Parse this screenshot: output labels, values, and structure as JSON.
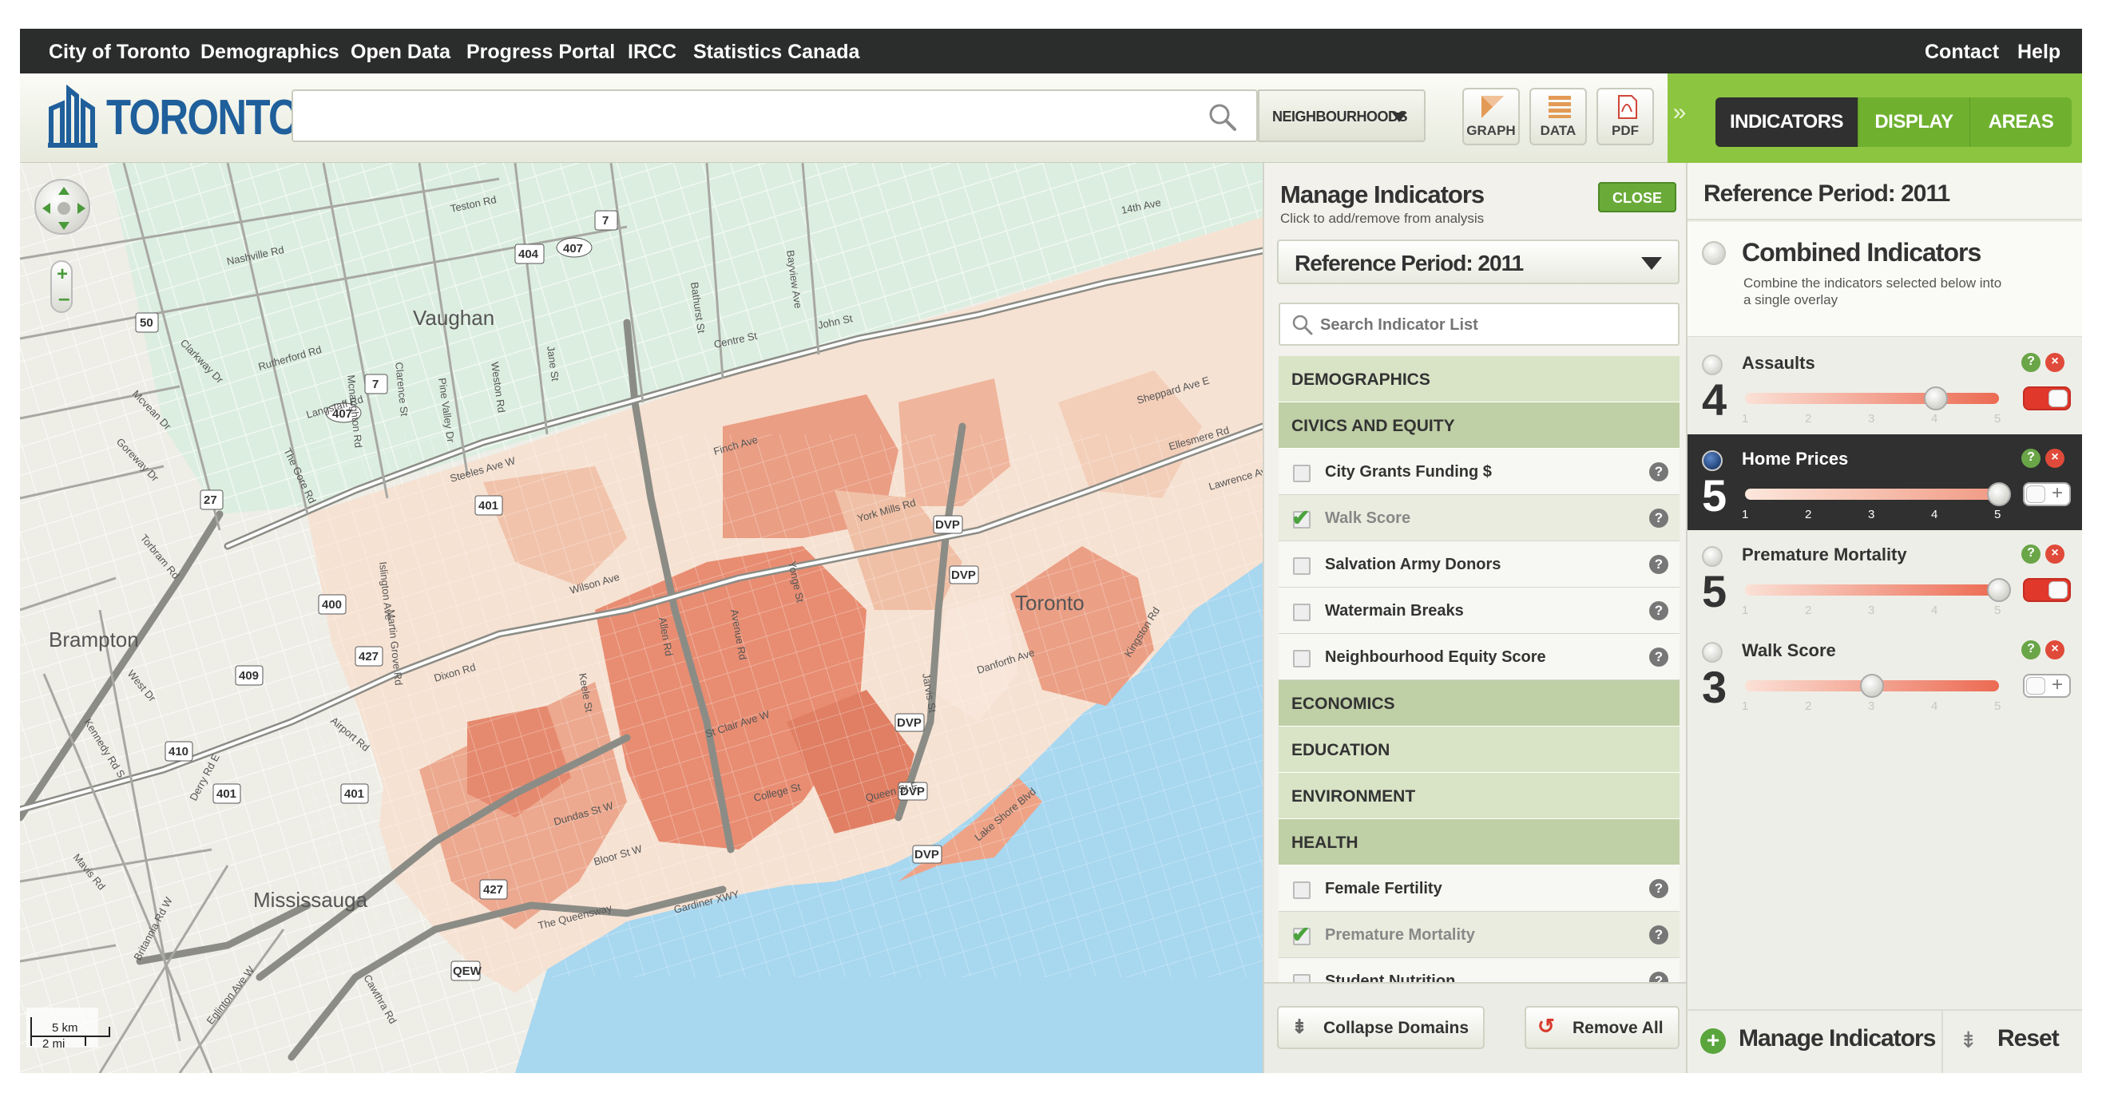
{
  "topnav": {
    "links": [
      "City of Toronto",
      "Demographics",
      "Open Data",
      "Progress Portal",
      "IRCC",
      "Statistics Canada"
    ],
    "right_links": [
      "Contact",
      "Help"
    ]
  },
  "header": {
    "logo_text": "TORONTO",
    "search": {
      "placeholder": "",
      "value": ""
    },
    "scope": "NEIGHBOURHOODS",
    "tools": [
      "GRAPH",
      "DATA",
      "PDF"
    ],
    "tabs": [
      "INDICATORS",
      "DISPLAY",
      "AREAS"
    ],
    "active_tab": "INDICATORS"
  },
  "map": {
    "cities": [
      "Vaughan",
      "Brampton",
      "Mississauga",
      "Toronto"
    ],
    "roads": [
      "Teston Rd",
      "Nashville Rd",
      "Rutherford Rd",
      "Langstaff Rd",
      "Steeles Ave W",
      "Centre St",
      "John St",
      "14th Ave",
      "Clarkway Dr",
      "Mcvean Dr",
      "Goreway Dr",
      "Torbram Rd",
      "West Dr",
      "Kennedy Rd S",
      "Airport Rd",
      "Derry Rd E",
      "Mavis Rd",
      "Britannia Rd W",
      "Eglinton Ave W",
      "Cawthra Rd",
      "Dundas St W",
      "Bloor St W",
      "The Queensway",
      "Gardiner XWY",
      "Lake Shore Blvd",
      "Danforth Ave",
      "Kingston Rd",
      "Sheppard Ave E",
      "Ellesmere Rd",
      "Lawrence Ave",
      "Wilson Ave",
      "Finch Ave",
      "York Mills Rd",
      "Yonge St",
      "Bathurst St",
      "Bayview Ave",
      "Jane St",
      "Weston Rd",
      "Pine Valley Dr",
      "Islington Ave",
      "Dixon Rd",
      "St Clair Ave W",
      "Avenue Rd",
      "Allen Rd",
      "Keele St",
      "Jarvis St",
      "College St",
      "Queen St E",
      "Martin Grove Rd",
      "The Gore Rd",
      "Clarence St",
      "Mcnaughton Rd"
    ],
    "shields": [
      "50",
      "7",
      "404",
      "407",
      "27",
      "407",
      "7",
      "401",
      "400",
      "409",
      "427",
      "410",
      "401",
      "401",
      "427",
      "DVP",
      "DVP",
      "DVP",
      "DVP",
      "DVP",
      "QEW"
    ],
    "scale_km": "5 km",
    "scale_mi": "2 mi"
  },
  "manage": {
    "title": "Manage Indicators",
    "subtitle": "Click to add/remove from analysis",
    "close": "CLOSE",
    "period": "Reference Period: 2011",
    "search_placeholder": "Search Indicator List",
    "list": [
      {
        "type": "domain",
        "label": "DEMOGRAPHICS",
        "open": false
      },
      {
        "type": "domain",
        "label": "CIVICS AND EQUITY",
        "open": true
      },
      {
        "type": "ind",
        "label": "City Grants Funding $",
        "checked": false
      },
      {
        "type": "ind",
        "label": "Walk Score",
        "checked": true
      },
      {
        "type": "ind",
        "label": "Salvation Army Donors",
        "checked": false
      },
      {
        "type": "ind",
        "label": "Watermain Breaks",
        "checked": false
      },
      {
        "type": "ind",
        "label": "Neighbourhood Equity Score",
        "checked": false
      },
      {
        "type": "domain",
        "label": "ECONOMICS",
        "open": true
      },
      {
        "type": "domain",
        "label": "EDUCATION",
        "open": false
      },
      {
        "type": "domain",
        "label": "ENVIRONMENT",
        "open": false
      },
      {
        "type": "domain",
        "label": "HEALTH",
        "open": true
      },
      {
        "type": "ind",
        "label": "Female Fertility",
        "checked": false
      },
      {
        "type": "ind",
        "label": "Premature Mortality",
        "checked": true
      },
      {
        "type": "ind",
        "label": "Student Nutrition",
        "checked": false
      }
    ],
    "collapse": "Collapse Domains",
    "remove_all": "Remove All"
  },
  "right": {
    "period": "Reference Period: 2011",
    "combined_title": "Combined Indicators",
    "combined_desc": "Combine the indicators selected below into a single overlay",
    "indicators": [
      {
        "name": "Assaults",
        "weight": "4",
        "level": 4,
        "toggle": "on",
        "active": false
      },
      {
        "name": "Home Prices",
        "weight": "5",
        "level": 5,
        "toggle": "off",
        "active": true
      },
      {
        "name": "Premature Mortality",
        "weight": "5",
        "level": 5,
        "toggle": "on",
        "active": false
      },
      {
        "name": "Walk Score",
        "weight": "3",
        "level": 3,
        "toggle": "off",
        "active": false
      }
    ],
    "ticks": [
      "1",
      "2",
      "3",
      "4",
      "5"
    ],
    "manage_btn": "Manage Indicators",
    "reset_btn": "Reset"
  },
  "colors": {
    "accent_green": "#8cc540",
    "tab_dark": "#2f302f",
    "choropleth_dark": "#d9694f",
    "choropleth_light": "#f6e2d3",
    "water": "#a8d7f0"
  }
}
